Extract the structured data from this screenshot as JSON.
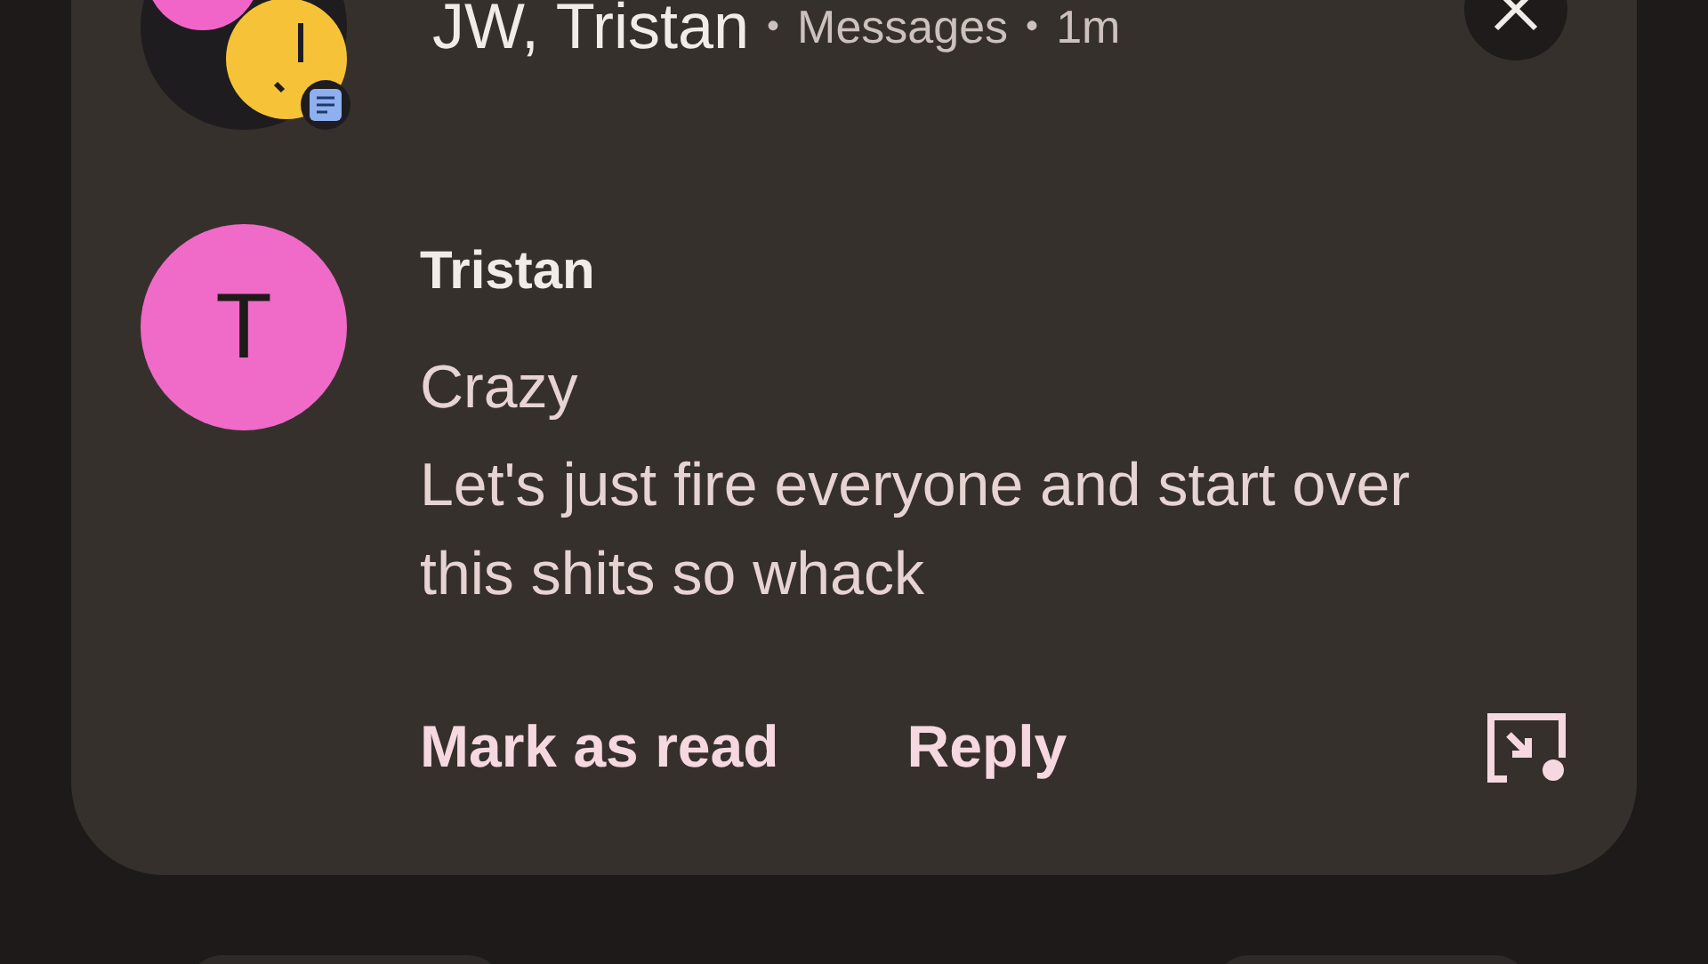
{
  "header": [
    {
      "kind": "title",
      "text": "JW, Tristan"
    },
    {
      "kind": "dot",
      "text": "•"
    },
    {
      "kind": "meta",
      "text": "Messages"
    },
    {
      "kind": "dot",
      "text": "•"
    },
    {
      "kind": "meta",
      "text": "1m"
    }
  ],
  "conversation": {
    "avatar_letter": "T",
    "sender": "Tristan",
    "messages": [
      "Crazy",
      "Let's just fire everyone and start over\nthis shits so whack"
    ]
  },
  "actions": [
    {
      "label": "Mark as read"
    },
    {
      "label": "Reply"
    }
  ]
}
